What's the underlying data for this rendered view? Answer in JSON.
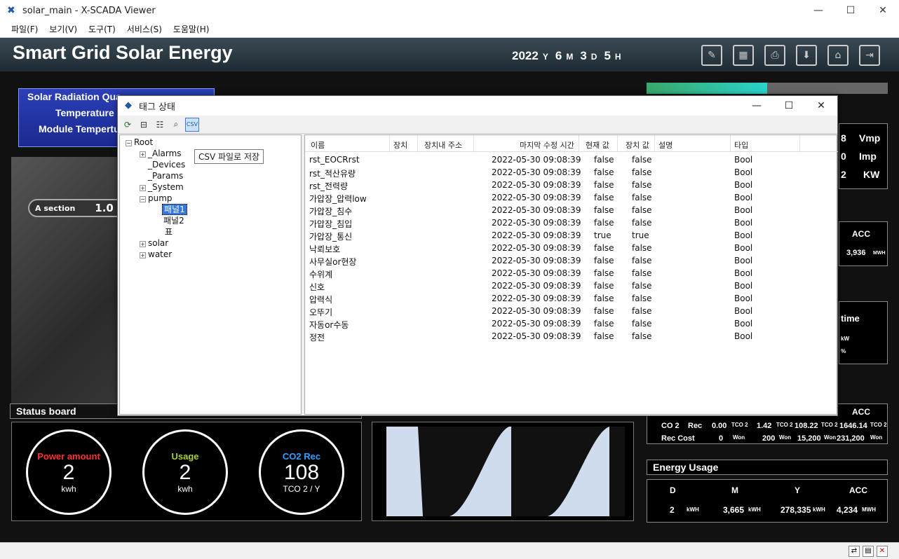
{
  "window": {
    "title": "solar_main - X-SCADA Viewer",
    "min": "—",
    "max": "☐",
    "close": "✕"
  },
  "menu": [
    "파일(F)",
    "보기(V)",
    "도구(T)",
    "서비스(S)",
    "도움말(H)"
  ],
  "header": {
    "title": "Smart Grid Solar Energy",
    "year": "2022",
    "year_unit": "Y",
    "month": "6",
    "month_unit": "M",
    "day": "3",
    "day_unit": "D",
    "hour": "5",
    "hour_unit": "H"
  },
  "left_panel": {
    "lines": [
      "Solar Radiation Qua",
      "Temperature",
      "Module Tempertu"
    ],
    "a_section_label": "A section",
    "a_section_value": "1.0"
  },
  "status_board": {
    "title": "Status board",
    "gauges": [
      {
        "label": "Power amount",
        "value": "2",
        "unit": "kwh",
        "color": "#ff3030"
      },
      {
        "label": "Usage",
        "value": "2",
        "unit": "kwh",
        "color": "#a8d030"
      },
      {
        "label": "CO2 Rec",
        "value": "108",
        "unit": "TCO 2 / Y",
        "color": "#30a0ff"
      }
    ]
  },
  "right_panel": {
    "vmp_value": "8",
    "vmp_label": "Vmp",
    "imp_value": "0",
    "imp_label": "Imp",
    "kw_value": "2",
    "kw_label": "KW",
    "acc_label": "ACC",
    "acc_value": "3,936",
    "acc_unit": "MWH",
    "time_label": "time",
    "kw_unit": "kW",
    "pct_unit": "%",
    "co2": {
      "acc_header": "ACC",
      "co2_label": "CO 2",
      "rec_label": "Rec",
      "co2_values": [
        "0.00",
        "1.42",
        "108.22",
        "1646.14"
      ],
      "co2_unit": "TCO 2",
      "cost_label": "Rec Cost",
      "cost_values": [
        "0",
        "200",
        "15,200",
        "231,200"
      ],
      "cost_unit": "Won"
    },
    "energy_usage": {
      "title": "Energy Usage",
      "headers": [
        "D",
        "M",
        "Y",
        "ACC"
      ],
      "values": [
        "2",
        "3,665",
        "278,335",
        "4,234"
      ],
      "units": [
        "kWH",
        "kWH",
        "kWH",
        "MWH"
      ]
    }
  },
  "dialog": {
    "title": "태그 상태",
    "tooltip": "CSV 파일로 저장",
    "tree": {
      "root": "Root",
      "items": [
        "_Alarms",
        "_Devices",
        "_Params",
        "_System",
        "pump",
        "패널1",
        "패널2",
        "표",
        "solar",
        "water"
      ]
    },
    "columns": [
      "이름",
      "장치",
      "장치내 주소",
      "마지막 수정 시간",
      "현재 값",
      "장치 값",
      "설명",
      "타입"
    ],
    "rows": [
      {
        "name": "rst_EOCRrst",
        "time": "2022-05-30 09:08:39",
        "cur": "false",
        "dev": "false",
        "type": "Bool"
      },
      {
        "name": "rst_적산유량",
        "time": "2022-05-30 09:08:39",
        "cur": "false",
        "dev": "false",
        "type": "Bool"
      },
      {
        "name": "rst_전력량",
        "time": "2022-05-30 09:08:39",
        "cur": "false",
        "dev": "false",
        "type": "Bool"
      },
      {
        "name": "가압장_압력low",
        "time": "2022-05-30 09:08:39",
        "cur": "false",
        "dev": "false",
        "type": "Bool"
      },
      {
        "name": "가압장_침수",
        "time": "2022-05-30 09:08:39",
        "cur": "false",
        "dev": "false",
        "type": "Bool"
      },
      {
        "name": "가압장_침입",
        "time": "2022-05-30 09:08:39",
        "cur": "false",
        "dev": "false",
        "type": "Bool"
      },
      {
        "name": "가압장_통신",
        "time": "2022-05-30 09:08:39",
        "cur": "true",
        "dev": "true",
        "type": "Bool"
      },
      {
        "name": "낙뢰보호",
        "time": "2022-05-30 09:08:39",
        "cur": "false",
        "dev": "false",
        "type": "Bool"
      },
      {
        "name": "사무실or현장",
        "time": "2022-05-30 09:08:39",
        "cur": "false",
        "dev": "false",
        "type": "Bool"
      },
      {
        "name": "수위계",
        "time": "2022-05-30 09:08:39",
        "cur": "false",
        "dev": "false",
        "type": "Bool"
      },
      {
        "name": "신호",
        "time": "2022-05-30 09:08:39",
        "cur": "false",
        "dev": "false",
        "type": "Bool"
      },
      {
        "name": "압력식",
        "time": "2022-05-30 09:08:39",
        "cur": "false",
        "dev": "false",
        "type": "Bool"
      },
      {
        "name": "오뚜기",
        "time": "2022-05-30 09:08:39",
        "cur": "false",
        "dev": "false",
        "type": "Bool"
      },
      {
        "name": "자동or수동",
        "time": "2022-05-30 09:08:39",
        "cur": "false",
        "dev": "false",
        "type": "Bool"
      },
      {
        "name": "정전",
        "time": "2022-05-30 09:08:39",
        "cur": "false",
        "dev": "false",
        "type": "Bool"
      }
    ]
  }
}
